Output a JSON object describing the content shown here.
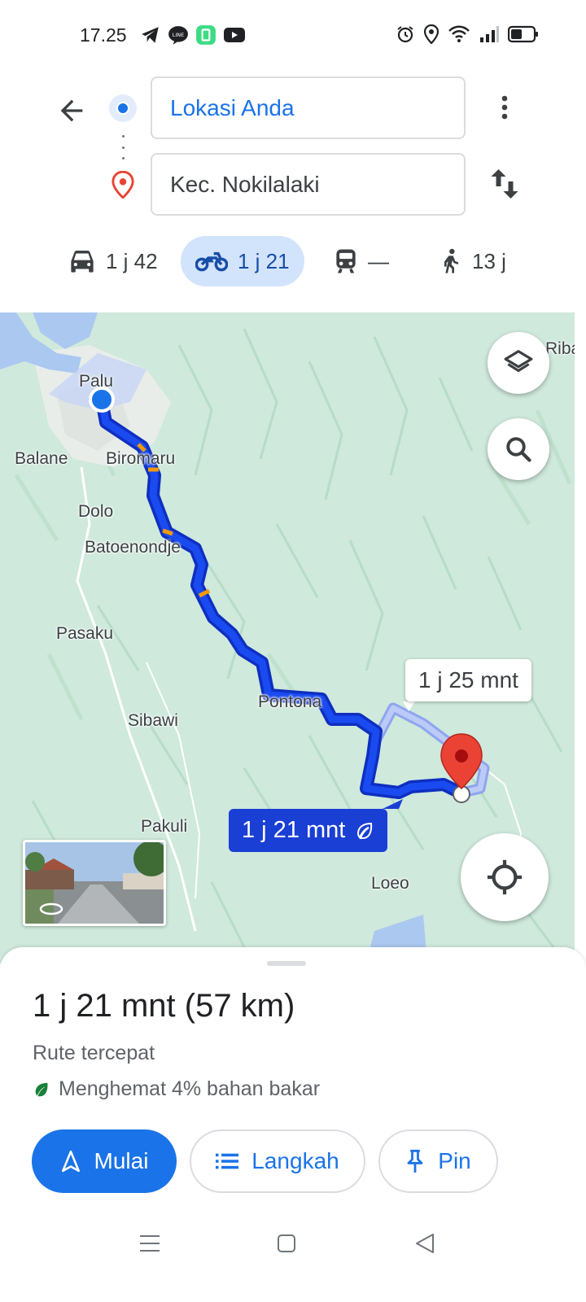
{
  "status_bar": {
    "time": "17.25",
    "app_icons": [
      "telegram-icon",
      "line-icon",
      "green-app-icon",
      "youtube-icon"
    ],
    "system_icons": [
      "alarm-icon",
      "location-icon",
      "wifi-icon",
      "signal-icon",
      "battery-icon"
    ]
  },
  "directions": {
    "origin": "Lokasi Anda",
    "destination": "Kec. Nokilalaki"
  },
  "modes": [
    {
      "name": "car",
      "label": "1 j 42",
      "active": false
    },
    {
      "name": "motorcycle",
      "label": "1 j 21",
      "active": true
    },
    {
      "name": "transit",
      "label": "—",
      "active": false
    },
    {
      "name": "walking",
      "label": "13 j",
      "active": false
    }
  ],
  "map": {
    "places": {
      "palu": "Palu",
      "balane": "Balane",
      "biromaru": "Biromaru",
      "dolo": "Dolo",
      "batoenondje": "Batoenondje",
      "pasaku": "Pasaku",
      "pontona": "Pontona",
      "sibawi": "Sibawi",
      "pakuli": "Pakuli",
      "loeo": "Loeo",
      "riba": "Riba"
    },
    "route_label_main": "1 j 21 mnt",
    "route_label_alt": "1 j 25 mnt",
    "colors": {
      "route": "#1a3fd4",
      "alt_route": "#a8baf5",
      "map_bg": "#cfe9dc",
      "water": "#aac8f0",
      "pin": "#ea4335"
    }
  },
  "sheet": {
    "title": "1 j 21 mnt (57 km)",
    "subtitle": "Rute tercepat",
    "fuel_note": "Menghemat 4% bahan bakar",
    "buttons": {
      "start": "Mulai",
      "steps": "Langkah",
      "pin": "Pin"
    }
  }
}
